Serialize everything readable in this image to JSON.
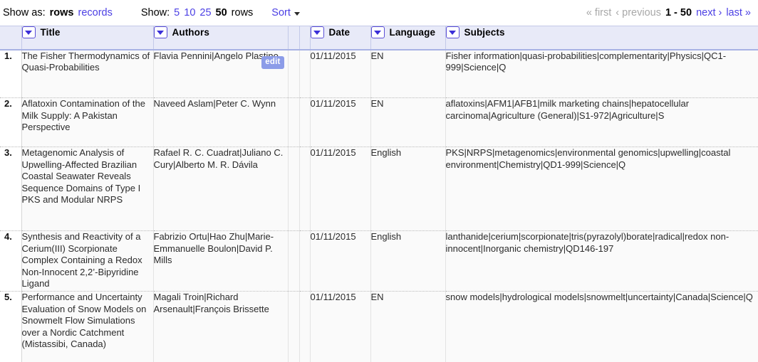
{
  "toolbar": {
    "show_as_label": "Show as:",
    "show_as_options": [
      {
        "label": "rows",
        "selected": true
      },
      {
        "label": "records",
        "selected": false
      }
    ],
    "show_as_rows": "rows",
    "show_as_records": "records",
    "show_label": "Show:",
    "page_sizes": [
      "5",
      "10",
      "25",
      "50"
    ],
    "page_size_5": "5",
    "page_size_10": "10",
    "page_size_25": "25",
    "page_size_50": "50",
    "rows_suffix": "rows",
    "sort_label": "Sort"
  },
  "pagination": {
    "first": "« first",
    "previous": "‹ previous",
    "range": "1 - 50",
    "next": "next ›",
    "last": "last »",
    "first_enabled": false,
    "previous_enabled": false,
    "next_enabled": true,
    "last_enabled": true
  },
  "table": {
    "columns": [
      {
        "key": "num",
        "label": ""
      },
      {
        "key": "title",
        "label": "Title"
      },
      {
        "key": "authors",
        "label": "Authors"
      },
      {
        "key": "blank1",
        "label": ""
      },
      {
        "key": "blank2",
        "label": ""
      },
      {
        "key": "date",
        "label": "Date"
      },
      {
        "key": "language",
        "label": "Language"
      },
      {
        "key": "subjects",
        "label": "Subjects"
      }
    ],
    "header": {
      "title": "Title",
      "authors": "Authors",
      "date": "Date",
      "language": "Language",
      "subjects": "Subjects"
    },
    "edit_badge_label": "edit",
    "rows": [
      {
        "num": "1.",
        "title": "The Fisher Thermodynamics of Quasi-Probabilities",
        "authors": "Flavia Pennini|Angelo Plastino",
        "date": "01/11/2015",
        "language": "EN",
        "subjects": "Fisher information|quasi-probabilities|complementarity|Physics|QC1-999|Science|Q",
        "has_edit": true
      },
      {
        "num": "2.",
        "title": "Aflatoxin Contamination of the Milk Supply: A Pakistan Perspective",
        "authors": "Naveed Aslam|Peter C. Wynn",
        "date": "01/11/2015",
        "language": "EN",
        "subjects": "aflatoxins|AFM1|AFB1|milk marketing chains|hepatocellular carcinoma|Agriculture (General)|S1-972|Agriculture|S",
        "has_edit": false
      },
      {
        "num": "3.",
        "title": "Metagenomic Analysis of Upwelling-Affected Brazilian Coastal Seawater Reveals Sequence Domains of Type I PKS and Modular NRPS",
        "authors": "Rafael R. C. Cuadrat|Juliano C. Cury|Alberto M. R. Dávila",
        "date": "01/11/2015",
        "language": "English",
        "subjects": "PKS|NRPS|metagenomics|environmental genomics|upwelling|coastal environment|Chemistry|QD1-999|Science|Q",
        "has_edit": false
      },
      {
        "num": "4.",
        "title": "Synthesis and Reactivity of a Cerium(III) Scorpionate Complex Containing a Redox Non-Innocent 2,2’-Bipyridine Ligand",
        "authors": "Fabrizio Ortu|Hao Zhu|Marie-Emmanuelle Boulon|David P. Mills",
        "date": "01/11/2015",
        "language": "English",
        "subjects": "lanthanide|cerium|scorpionate|tris(pyrazolyl)borate|radical|redox non-innocent|Inorganic chemistry|QD146-197",
        "has_edit": false
      },
      {
        "num": "5.",
        "title": "Performance and Uncertainty Evaluation of Snow Models on Snowmelt Flow Simulations over a Nordic Catchment (Mistassibi, Canada)",
        "authors": "Magali Troin|Richard Arsenault|François Brissette",
        "date": "01/11/2015",
        "language": "EN",
        "subjects": "snow models|hydrological models|snowmelt|uncertainty|Canada|Science|Q",
        "has_edit": false
      }
    ]
  },
  "colors": {
    "link": "#4b3fe4",
    "header_bg": "#e8eaf8",
    "header_border": "#a8b2e4",
    "edit_badge_bg": "#8c9ce8",
    "row_bg": "#fafafa",
    "disabled_text": "#a8a8a8"
  }
}
